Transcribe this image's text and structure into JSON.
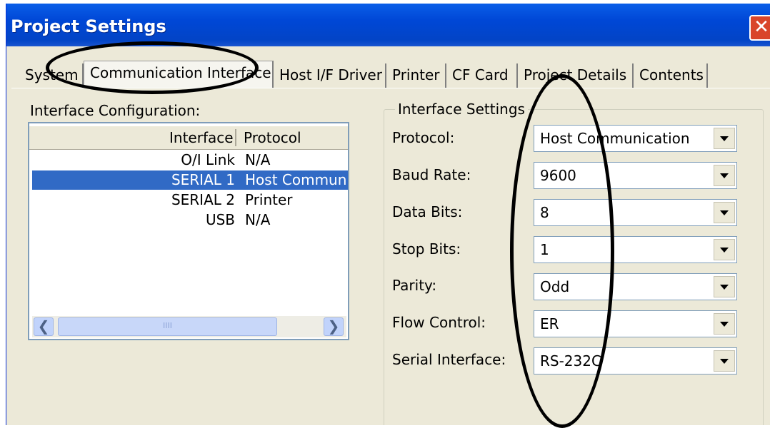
{
  "window": {
    "title": "Project Settings",
    "close_glyph": "✕"
  },
  "tabs": [
    {
      "label": "System"
    },
    {
      "label": "Communication Interface"
    },
    {
      "label": "Host I/F Driver"
    },
    {
      "label": "Printer"
    },
    {
      "label": "CF Card"
    },
    {
      "label": "Project Details"
    },
    {
      "label": "Contents"
    }
  ],
  "active_tab": "Communication Interface",
  "interface_config": {
    "label": "Interface Configuration:",
    "columns": [
      "Interface",
      "Protocol"
    ],
    "rows": [
      {
        "interface": "O/I Link",
        "protocol": "N/A"
      },
      {
        "interface": "SERIAL 1",
        "protocol": "Host Communi",
        "selected": true
      },
      {
        "interface": "SERIAL 2",
        "protocol": "Printer"
      },
      {
        "interface": "USB",
        "protocol": "N/A"
      }
    ],
    "scroll": {
      "left_icon": "chevron-left-icon",
      "right_icon": "chevron-right-icon",
      "grip": "IIII"
    }
  },
  "interface_settings": {
    "title": "Interface Settings",
    "fields": [
      {
        "label": "Protocol:",
        "value": "Host Communication"
      },
      {
        "label": "Baud Rate:",
        "value": "9600"
      },
      {
        "label": "Data Bits:",
        "value": "8"
      },
      {
        "label": "Stop Bits:",
        "value": "1"
      },
      {
        "label": "Parity:",
        "value": "Odd"
      },
      {
        "label": "Flow Control:",
        "value": "ER"
      },
      {
        "label": "Serial Interface:",
        "value": "RS-232C"
      }
    ]
  },
  "colors": {
    "title_bar": "#0047d6",
    "selection": "#316ac5",
    "dialog": "#ece9d8",
    "annotation": "#000000"
  }
}
